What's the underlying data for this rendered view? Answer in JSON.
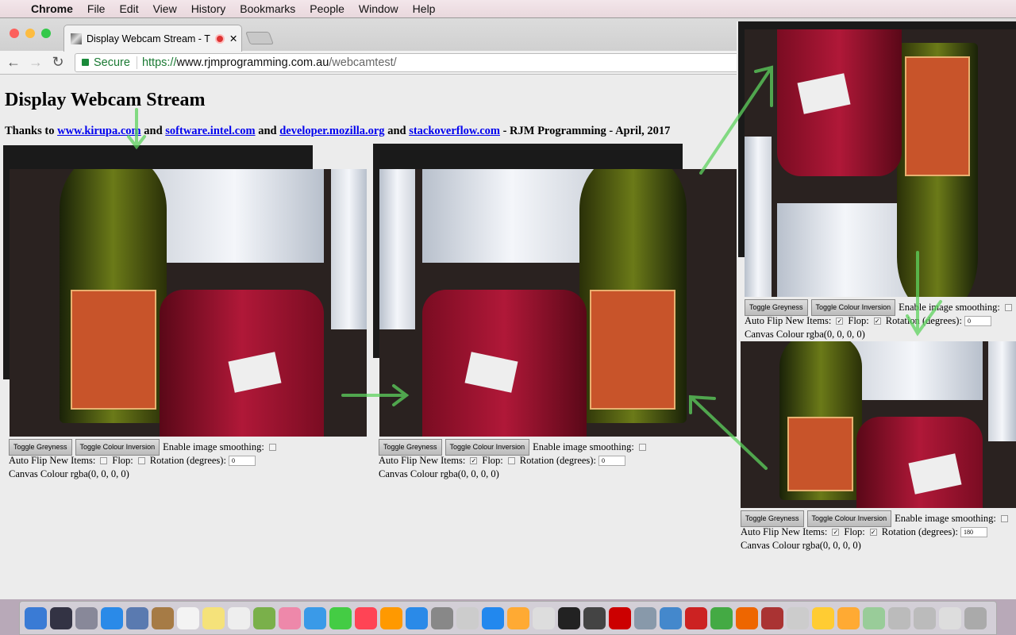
{
  "menubar": {
    "app": "Chrome",
    "items": [
      "File",
      "Edit",
      "View",
      "History",
      "Bookmarks",
      "People",
      "Window",
      "Help"
    ]
  },
  "browser": {
    "tab_title": "Display Webcam Stream - T",
    "secure": "Secure",
    "url_scheme": "https://",
    "url_host": "www.rjmprogramming.com.au",
    "url_path": "/webcamtest/"
  },
  "page": {
    "title": "Display Webcam Stream",
    "thanks_prefix": "Thanks to ",
    "links": [
      "www.kirupa.com",
      "software.intel.com",
      "developer.mozilla.org",
      "stackoverflow.com"
    ],
    "and": " and ",
    "suffix": " - RJM Programming - April, 2017"
  },
  "controls": {
    "greyness": "Toggle Greyness",
    "inversion": "Toggle Colour Inversion",
    "smoothing": "Enable image smoothing:",
    "autoflip": "Auto Flip New Items:",
    "flop": "Flop:",
    "rotation": "Rotation (degrees):",
    "canvas_colour": "Canvas Colour rgba(0, 0, 0, 0)"
  },
  "panels": [
    {
      "auto_flip": false,
      "flop": false,
      "smoothing": false,
      "rotation": "0"
    },
    {
      "auto_flip": true,
      "flop": false,
      "smoothing": false,
      "rotation": "0"
    },
    {
      "auto_flip": true,
      "flop": true,
      "smoothing": false,
      "rotation": "0"
    },
    {
      "auto_flip": true,
      "flop": true,
      "smoothing": false,
      "rotation": "180"
    }
  ],
  "colors": {
    "arrow": "#5ed35e",
    "link": "#0000ee"
  }
}
